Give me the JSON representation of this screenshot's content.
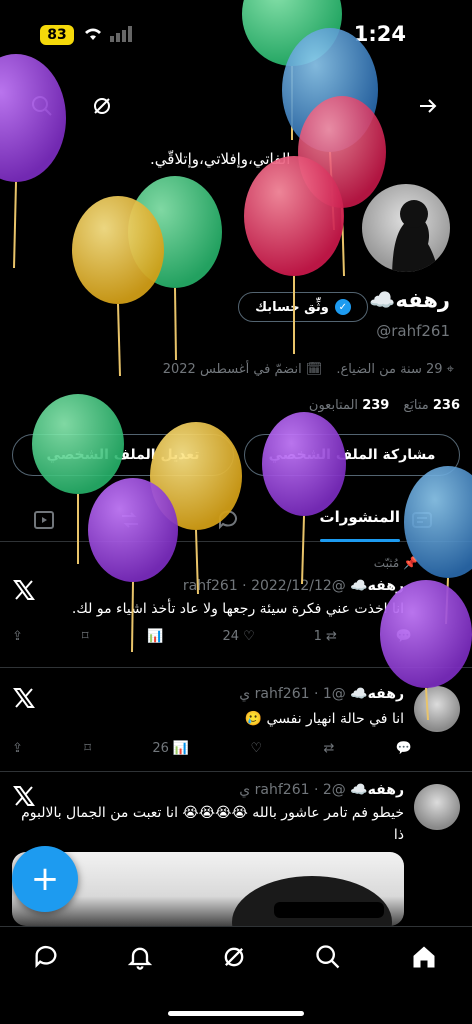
{
  "status": {
    "battery": "83",
    "time": "1:24"
  },
  "profile": {
    "bio_quote": "الفاتي،وإفلاتي،وإتلاقّي.",
    "name": "رهفه☁️",
    "verify_label": "وثِّق حسابك",
    "handle": "@rahf261",
    "location": "29 سنة من الضياع.",
    "joined": "انضمّ في أغسطس 2022",
    "following_count": "236",
    "following_label": "متابَع",
    "followers_count": "239",
    "followers_label": "المتابعون"
  },
  "buttons": {
    "share": "مشاركة الملف الشخصي",
    "edit": "تعديل الملف الشخصي"
  },
  "tabs": {
    "active": "المنشورات"
  },
  "posts": [
    {
      "pinned_label": "مُثبّت",
      "name": "رهفه☁️",
      "meta": "@rahf261 · 2022/12/12",
      "text": "انا اخذت عني فكرة سيئة رجعها ولا عاد تأخذ اشياء مو لك.",
      "likes": "24",
      "retweets": "1"
    },
    {
      "name": "رهفه☁️",
      "meta": "@rahf261 · 1 ي",
      "text": "انا في حالة انهيار نفسي 🥲",
      "views": "26"
    },
    {
      "name": "رهفه☁️",
      "meta": "@rahf261 · 2 ي",
      "text": "خيطو فم تامر عاشور بالله 😭😭😭😭 انا تعبت من الجمال بالالبوم ذا"
    }
  ],
  "colors": {
    "accent": "#1d9bf0",
    "background": "#000000",
    "muted": "#71767b"
  },
  "icons": [
    "search-icon",
    "no-notify-icon",
    "back-arrow-icon",
    "x-logo-icon",
    "pin-icon",
    "home-icon",
    "bell-icon",
    "messages-icon"
  ]
}
